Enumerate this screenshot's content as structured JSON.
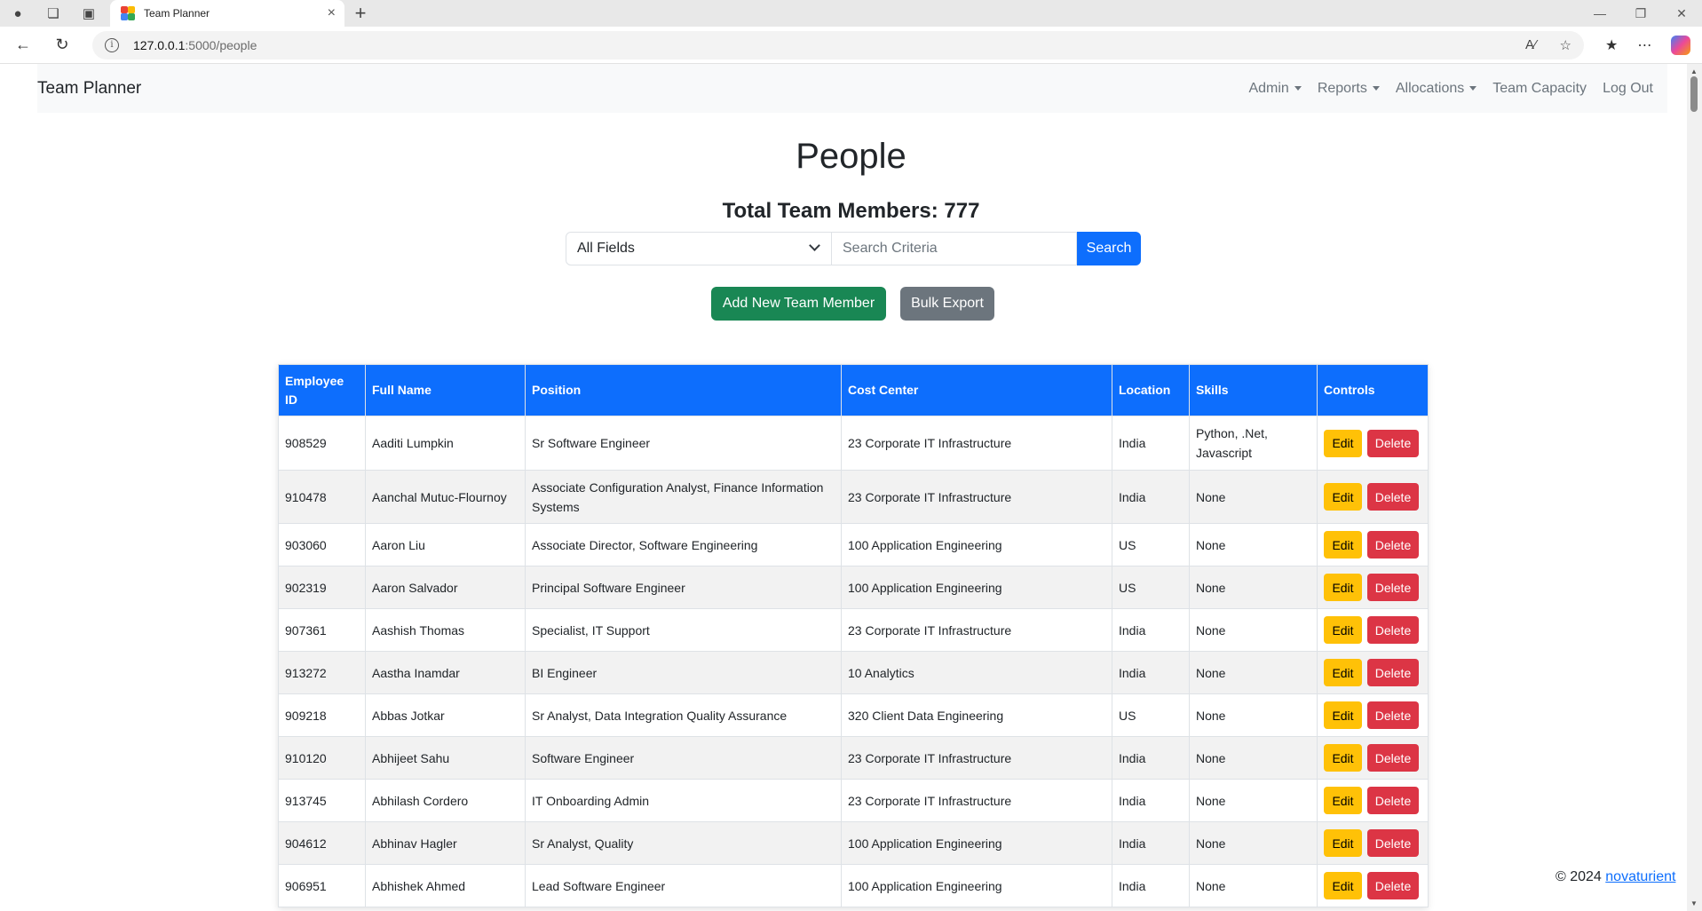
{
  "browser": {
    "tab_title": "Team Planner",
    "url_host": "127.0.0.1",
    "url_path": ":5000/people"
  },
  "navbar": {
    "brand": "Team Planner",
    "links": [
      "Admin",
      "Reports",
      "Allocations",
      "Team Capacity",
      "Log Out"
    ]
  },
  "page": {
    "title": "People",
    "total_label": "Total Team Members: 777"
  },
  "search": {
    "field_selected": "All Fields",
    "placeholder": "Search Criteria",
    "button": "Search"
  },
  "actions": {
    "add": "Add New Team Member",
    "export": "Bulk Export"
  },
  "table": {
    "headers": [
      "Employee ID",
      "Full Name",
      "Position",
      "Cost Center",
      "Location",
      "Skills",
      "Controls"
    ],
    "edit_label": "Edit",
    "delete_label": "Delete",
    "rows": [
      [
        "908529",
        "Aaditi Lumpkin",
        "Sr Software Engineer",
        "23 Corporate IT Infrastructure",
        "India",
        "Python, .Net, Javascript"
      ],
      [
        "910478",
        "Aanchal Mutuc-Flournoy",
        "Associate Configuration Analyst, Finance Information Systems",
        "23 Corporate IT Infrastructure",
        "India",
        "None"
      ],
      [
        "903060",
        "Aaron Liu",
        "Associate Director, Software Engineering",
        "100 Application Engineering",
        "US",
        "None"
      ],
      [
        "902319",
        "Aaron Salvador",
        "Principal Software Engineer",
        "100 Application Engineering",
        "US",
        "None"
      ],
      [
        "907361",
        "Aashish Thomas",
        "Specialist, IT Support",
        "23 Corporate IT Infrastructure",
        "India",
        "None"
      ],
      [
        "913272",
        "Aastha Inamdar",
        "BI Engineer",
        "10 Analytics",
        "India",
        "None"
      ],
      [
        "909218",
        "Abbas Jotkar",
        "Sr Analyst, Data Integration Quality Assurance",
        "320 Client Data Engineering",
        "US",
        "None"
      ],
      [
        "910120",
        "Abhijeet Sahu",
        "Software Engineer",
        "23 Corporate IT Infrastructure",
        "India",
        "None"
      ],
      [
        "913745",
        "Abhilash Cordero",
        "IT Onboarding Admin",
        "23 Corporate IT Infrastructure",
        "India",
        "None"
      ],
      [
        "904612",
        "Abhinav Hagler",
        "Sr Analyst, Quality",
        "100 Application Engineering",
        "India",
        "None"
      ],
      [
        "906951",
        "Abhishek Ahmed",
        "Lead Software Engineer",
        "100 Application Engineering",
        "India",
        "None"
      ]
    ]
  },
  "footer": {
    "copyright": "© 2024",
    "link": "novaturient"
  }
}
